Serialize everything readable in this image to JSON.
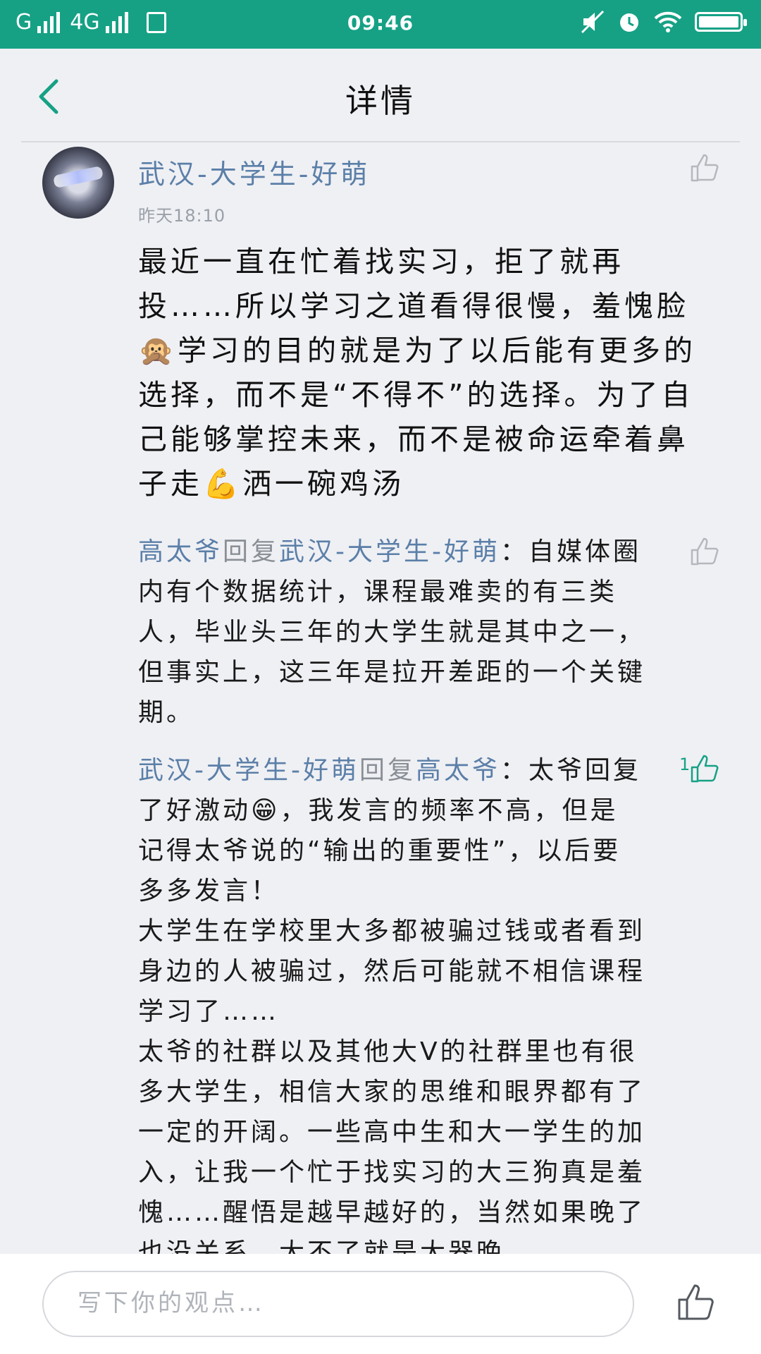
{
  "status_bar": {
    "carrier1": "G",
    "carrier2": "4G",
    "time": "09:46"
  },
  "header": {
    "title": "详情"
  },
  "post": {
    "username": "武汉-大学生-好萌",
    "time": "昨天18:10",
    "text": "最近一直在忙着找实习，拒了就再投……所以学习之道看得很慢，羞愧脸🙊学习的目的就是为了以后能有更多的选择，而不是“不得不”的选择。为了自己能够掌控未来，而不是被命运牵着鼻子走💪洒一碗鸡汤"
  },
  "comments": [
    {
      "from": "高太爷",
      "reply_word": "回复",
      "to": "武汉-大学生-好萌",
      "paragraphs": [
        "：自媒体圈内有个数据统计，课程最难卖的有三类人，毕业头三年的大学生就是其中之一，但事实上，这三年是拉开差距的一个关键期。"
      ],
      "likes": ""
    },
    {
      "from": "武汉-大学生-好萌",
      "reply_word": "回复",
      "to": "高太爷",
      "paragraphs": [
        "：太爷回复了好激动😁，我发言的频率不高，但是记得太爷说的“输出的重要性”，以后要多多发言！",
        "大学生在学校里大多都被骗过钱或者看到身边的人被骗过，然后可能就不相信课程学习了……",
        "太爷的社群以及其他大V的社群里也有很多大学生，相信大家的思维和眼界都有了一定的开阔。一些高中生和大一学生的加入，让我一个忙于找实习的大三狗真是羞愧……醒悟是越早越好的，当然如果晚了也没关系，大不了就是大器晚"
      ],
      "likes": "1"
    }
  ],
  "bottom_bar": {
    "placeholder": "写下你的观点…"
  }
}
